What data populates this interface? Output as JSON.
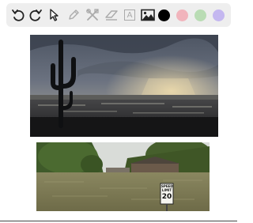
{
  "toolbar": {
    "tools": [
      {
        "name": "undo-icon",
        "active": true
      },
      {
        "name": "redo-icon",
        "active": true
      },
      {
        "name": "select-arrow-icon",
        "active": true
      },
      {
        "name": "pen-icon",
        "active": false
      },
      {
        "name": "tools-icon",
        "active": false
      },
      {
        "name": "eraser-icon",
        "active": false
      },
      {
        "name": "text-icon",
        "active": false,
        "glyph": "A"
      },
      {
        "name": "image-icon",
        "active": true
      }
    ],
    "colors": [
      "#000000",
      "#f1b4bc",
      "#b9dcb4",
      "#c4b7f0"
    ]
  },
  "canvas": {
    "photo1": {
      "subject": "storm-cactus-city"
    },
    "photo2": {
      "subject": "flooded-street",
      "sign_line1": "SPEED",
      "sign_line2": "LIMIT",
      "sign_number": "20"
    }
  }
}
